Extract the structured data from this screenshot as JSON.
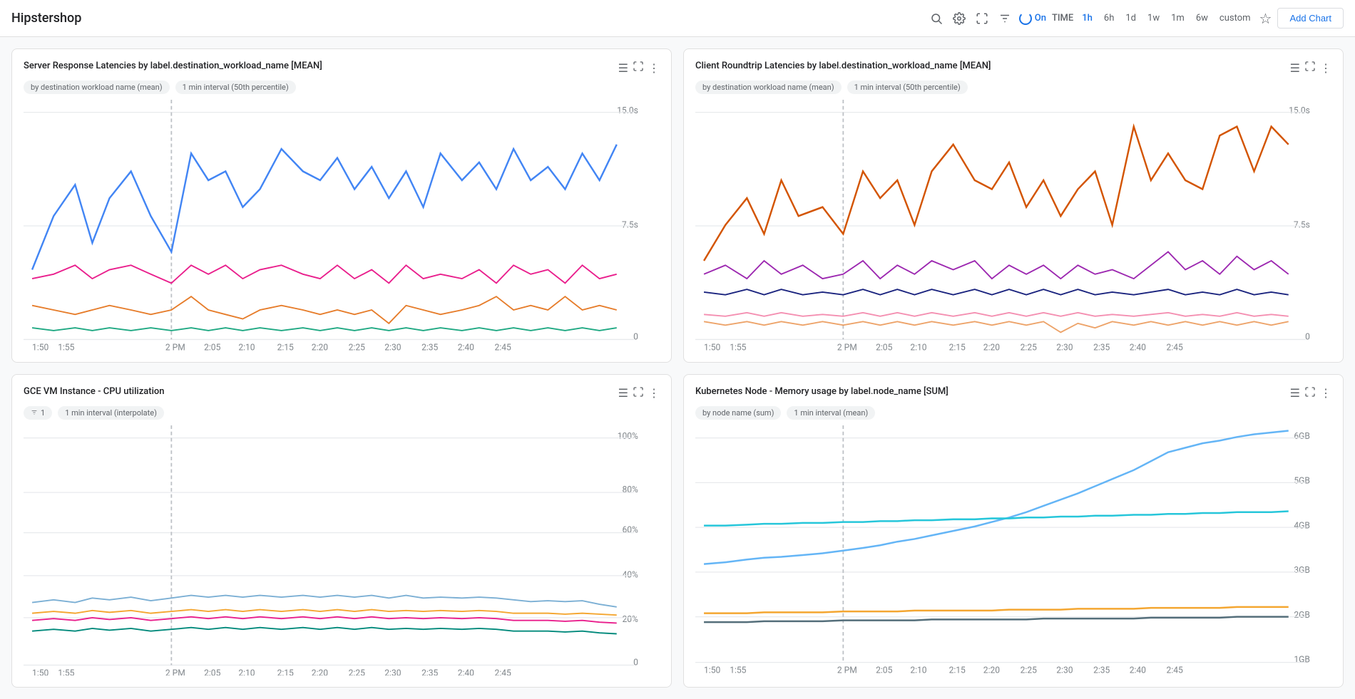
{
  "header": {
    "title": "Hipstershop",
    "search_icon": "🔍",
    "settings_icon": "⚙",
    "expand_icon": "⛶",
    "filter_icon": "≡",
    "live_label": "On",
    "time_label": "TIME",
    "time_options": [
      "1h",
      "6h",
      "1d",
      "1w",
      "1m",
      "6w",
      "custom"
    ],
    "active_time": "1h",
    "star_icon": "☆",
    "add_chart_label": "Add Chart"
  },
  "charts": [
    {
      "id": "chart1",
      "title": "Server Response Latencies by label.destination_workload_name [MEAN]",
      "tags": [
        "by destination workload name (mean)",
        "1 min interval (50th percentile)"
      ],
      "y_max": "15.0s",
      "y_mid": "7.5s",
      "y_min": "0",
      "x_labels": [
        "1:50",
        "1:55",
        "2 PM",
        "2:05",
        "2:10",
        "2:15",
        "2:20",
        "2:25",
        "2:30",
        "2:35",
        "2:40",
        "2:45"
      ]
    },
    {
      "id": "chart2",
      "title": "Client Roundtrip Latencies by label.destination_workload_name [MEAN]",
      "tags": [
        "by destination workload name (mean)",
        "1 min interval (50th percentile)"
      ],
      "y_max": "15.0s",
      "y_mid": "7.5s",
      "y_min": "0",
      "x_labels": [
        "1:50",
        "1:55",
        "2 PM",
        "2:05",
        "2:10",
        "2:15",
        "2:20",
        "2:25",
        "2:30",
        "2:35",
        "2:40",
        "2:45"
      ]
    },
    {
      "id": "chart3",
      "title": "GCE VM Instance - CPU utilization",
      "tags": [
        "1",
        "1 min interval (interpolate)"
      ],
      "filter_tag": true,
      "y_max": "100%",
      "y_mid": "60%",
      "y_min": "0",
      "x_labels": [
        "1:50",
        "1:55",
        "2 PM",
        "2:05",
        "2:10",
        "2:15",
        "2:20",
        "2:25",
        "2:30",
        "2:35",
        "2:40",
        "2:45"
      ]
    },
    {
      "id": "chart4",
      "title": "Kubernetes Node - Memory usage by label.node_name [SUM]",
      "tags": [
        "by node name (sum)",
        "1 min interval (mean)"
      ],
      "y_max": "6GB",
      "y_mid": "4GB",
      "y_min": "1GB",
      "x_labels": [
        "1:50",
        "1:55",
        "2 PM",
        "2:05",
        "2:10",
        "2:15",
        "2:20",
        "2:25",
        "2:30",
        "2:35",
        "2:40",
        "2:45"
      ]
    }
  ]
}
